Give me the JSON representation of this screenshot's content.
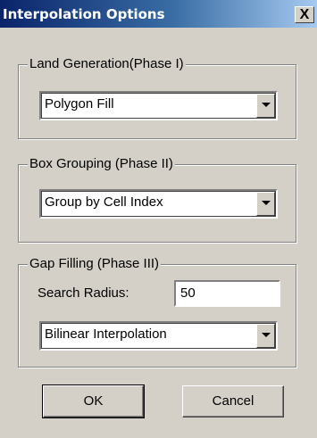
{
  "window": {
    "title": "Interpolation Options",
    "close_label": "X"
  },
  "land_generation": {
    "legend": "Land Generation(Phase I)",
    "selected": "Polygon Fill"
  },
  "box_grouping": {
    "legend": "Box Grouping (Phase II)",
    "selected": "Group by Cell Index"
  },
  "gap_filling": {
    "legend": "Gap Filling (Phase III)",
    "search_radius_label": "Search Radius:",
    "search_radius_value": "50",
    "selected": "Bilinear Interpolation"
  },
  "buttons": {
    "ok": "OK",
    "cancel": "Cancel"
  }
}
